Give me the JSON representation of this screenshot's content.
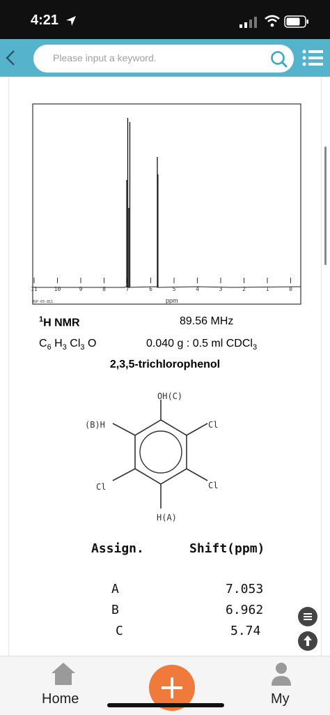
{
  "status": {
    "time": "4:21"
  },
  "search": {
    "placeholder": "Please input a keyword."
  },
  "spectrum": {
    "ticks": [
      "11",
      "10",
      "9",
      "8",
      "7",
      "6",
      "5",
      "4",
      "3",
      "2",
      "1",
      "0"
    ],
    "axis_label": "ppm",
    "code": "HSP-03-811"
  },
  "info": {
    "nucleus_sup": "1",
    "nucleus": "H NMR",
    "frequency": "89.56 MHz",
    "formula": {
      "c": "C",
      "c_n": "6",
      "h": " H",
      "h_n": "3",
      "cl": " Cl",
      "cl_n": "3",
      "o": " O"
    },
    "conc_prefix": "0.040 g : 0.5 ml CDCl",
    "conc_sub": "3",
    "compound": "2,3,5-trichlorophenol"
  },
  "structure": {
    "oh": "OH(C)",
    "bh": "(B)H",
    "cl_top": "Cl",
    "cl_left": "Cl",
    "cl_right": "Cl",
    "ha": "H(A)"
  },
  "table": {
    "header_assign": "Assign.",
    "header_shift": "Shift(ppm)",
    "rows": [
      {
        "assign": "A",
        "shift": "7.053"
      },
      {
        "assign": "B",
        "shift": "6.962"
      },
      {
        "assign": "C",
        "shift": "5.74"
      }
    ]
  },
  "nav": {
    "home": "Home",
    "my": "My"
  },
  "colors": {
    "accent": "#55b3cc",
    "add": "#f07a3c"
  }
}
